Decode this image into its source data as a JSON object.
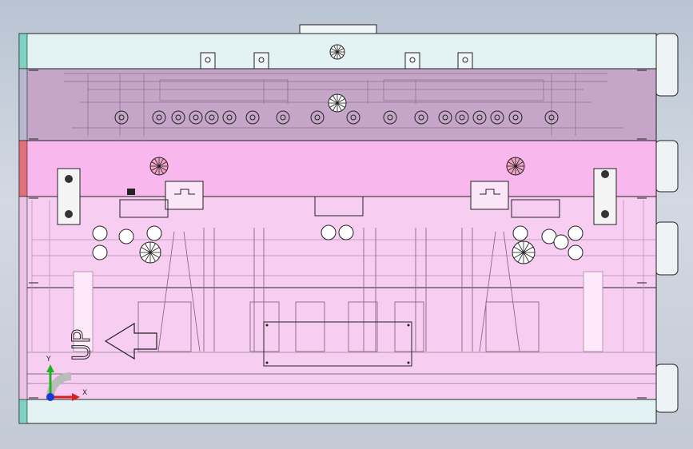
{
  "view": {
    "background_top": "#b9c4d3",
    "background_bottom": "#c3cad6"
  },
  "colors": {
    "top_clamp_plate": "#e3f3f4",
    "upper_plate": "#c6a6c8",
    "stripper_plate": "#f8b8ee",
    "die_zone": "#f7cdf1",
    "bottom_plate": "#e3f3f4",
    "edge_cyan": "#7fd1c3",
    "edge_red": "#e0707a",
    "outline": "#1a1a1a"
  },
  "model": {
    "direction_label": "UP",
    "direction_arrow": "left-arrow-outline"
  },
  "triad": {
    "x_label": "X",
    "y_label": "Y",
    "x_color": "#d81e1e",
    "y_color": "#1fb31f",
    "z_color": "#1a37d8"
  }
}
